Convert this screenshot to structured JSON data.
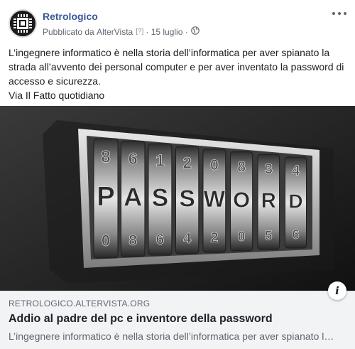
{
  "post": {
    "page_name": "Retrologico",
    "published_prefix": "Pubblicato da",
    "publisher": "AlterVista",
    "help_mark": "[?]",
    "separator": "·",
    "date": "15 luglio",
    "separator2": "·",
    "privacy_icon": "globe-icon",
    "more_icon": "more-options-icon",
    "text_lines": [
      "L’ingegnere informatico è nella storia dell’informatica per aver spianato la strada all’avvento dei personal computer e per aver inventato la password di accesso e sicurezza.",
      "Via Il Fatto quotidiano"
    ]
  },
  "image": {
    "description_icon": "password-combination-lock-image",
    "top_digits": [
      "8",
      "6",
      "1",
      "2",
      "0",
      "8",
      "3",
      "4"
    ],
    "word_letters": [
      "P",
      "A",
      "S",
      "S",
      "W",
      "O",
      "R",
      "D"
    ],
    "bottom_digits": [
      "0",
      "8",
      "6",
      "4",
      "2",
      "0",
      "5",
      "6"
    ]
  },
  "link": {
    "domain": "RETROLOGICO.ALTERVISTA.ORG",
    "title": "Addio al padre del pc e inventore della password",
    "description": "L’ingegnere informatico è nella storia dell’informatica per aver spianato la strada all’avvento dei personal computer",
    "info_label": "i"
  }
}
